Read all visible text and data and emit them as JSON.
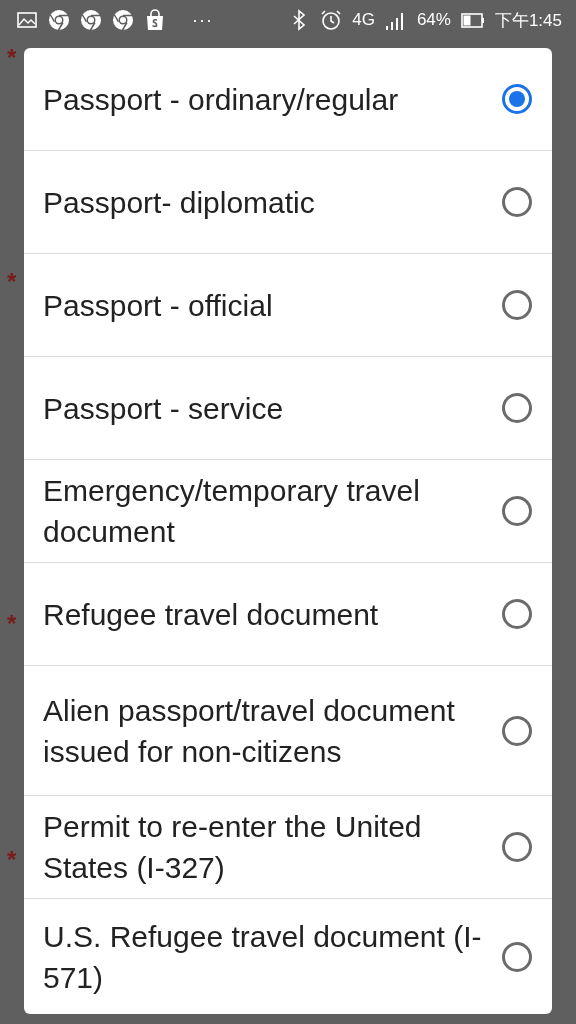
{
  "status_bar": {
    "more": "···",
    "network": "4G",
    "battery": "64%",
    "time": "下午1:45"
  },
  "background_marks": [
    "*",
    "*",
    "*",
    "*"
  ],
  "options": [
    {
      "label": "Passport - ordinary/regular",
      "selected": true
    },
    {
      "label": "Passport- diplomatic",
      "selected": false
    },
    {
      "label": "Passport - official",
      "selected": false
    },
    {
      "label": "Passport - service",
      "selected": false
    },
    {
      "label": "Emergency/temporary travel document",
      "selected": false
    },
    {
      "label": "Refugee travel document",
      "selected": false
    },
    {
      "label": "Alien passport/travel document issued for non-citizens",
      "selected": false
    },
    {
      "label": "Permit to re-enter the United States (I-327)",
      "selected": false
    },
    {
      "label": "U.S. Refugee travel document (I-571)",
      "selected": false
    }
  ]
}
